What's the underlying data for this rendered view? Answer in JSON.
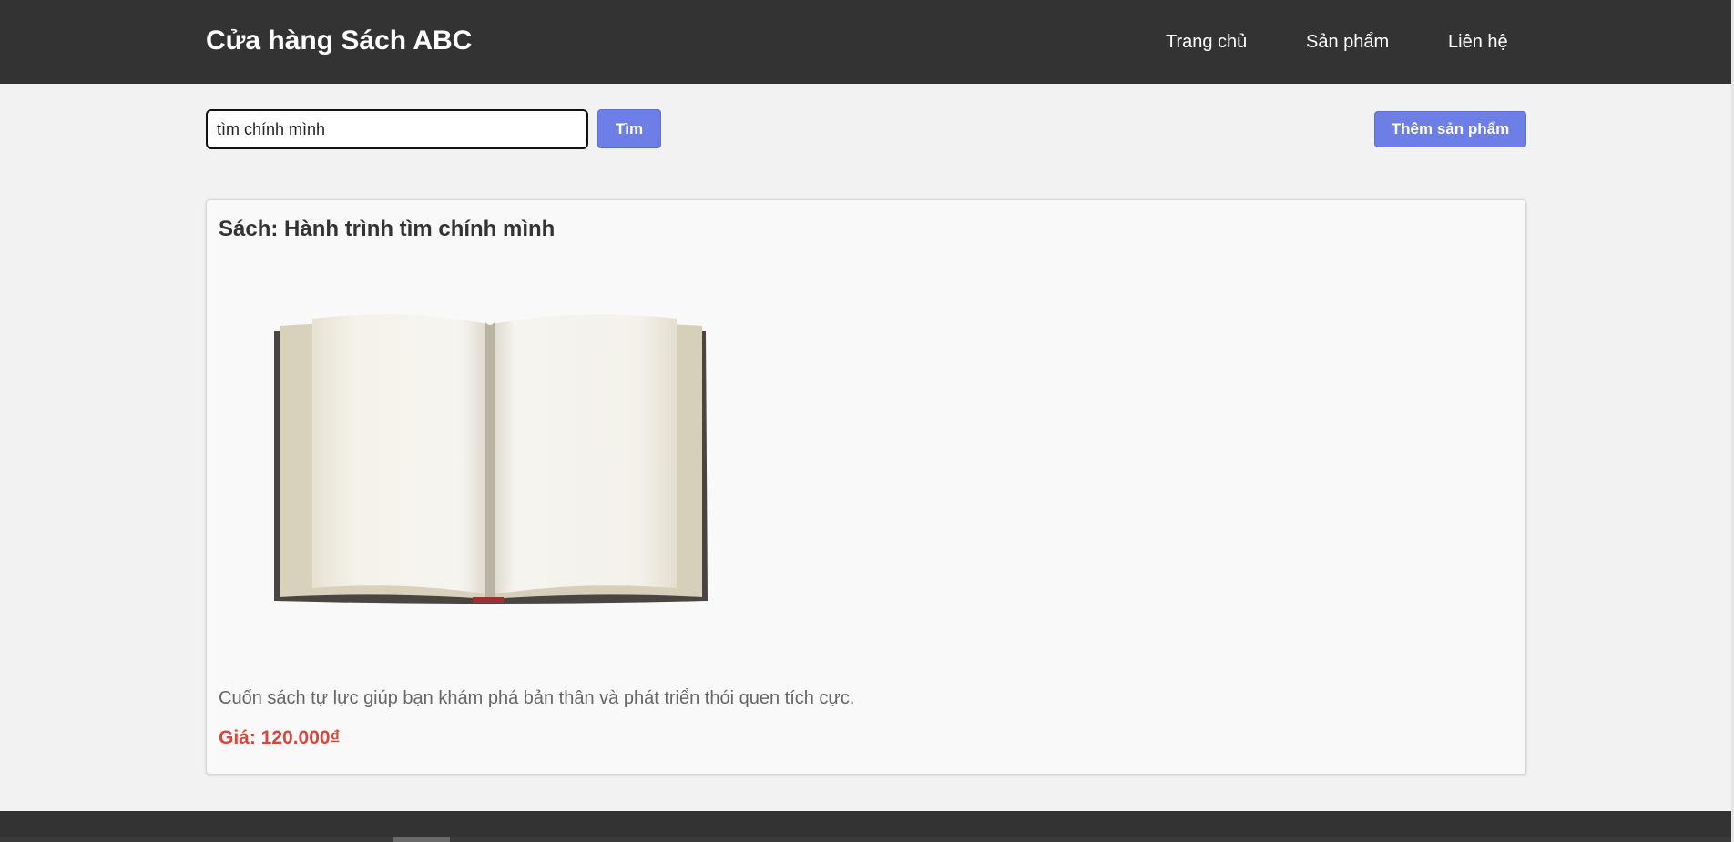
{
  "header": {
    "brand": "Cửa hàng Sách ABC",
    "nav": [
      {
        "label": "Trang chủ"
      },
      {
        "label": "Sản phẩm"
      },
      {
        "label": "Liên hệ"
      }
    ]
  },
  "toolbar": {
    "search_value": "tìm chính mình",
    "search_button": "Tìm",
    "add_button": "Thêm sản phẩm"
  },
  "product": {
    "title": "Sách: Hành trình tìm chính mình",
    "image_icon": "open-book",
    "description": "Cuốn sách tự lực giúp bạn khám phá bản thân và phát triển thói quen tích cực.",
    "price": "Giá: 120.000₫"
  },
  "colors": {
    "header_bg": "#333333",
    "accent": "#6d7fe6",
    "price": "#d9463b",
    "page_bg": "#f2f2f2"
  }
}
